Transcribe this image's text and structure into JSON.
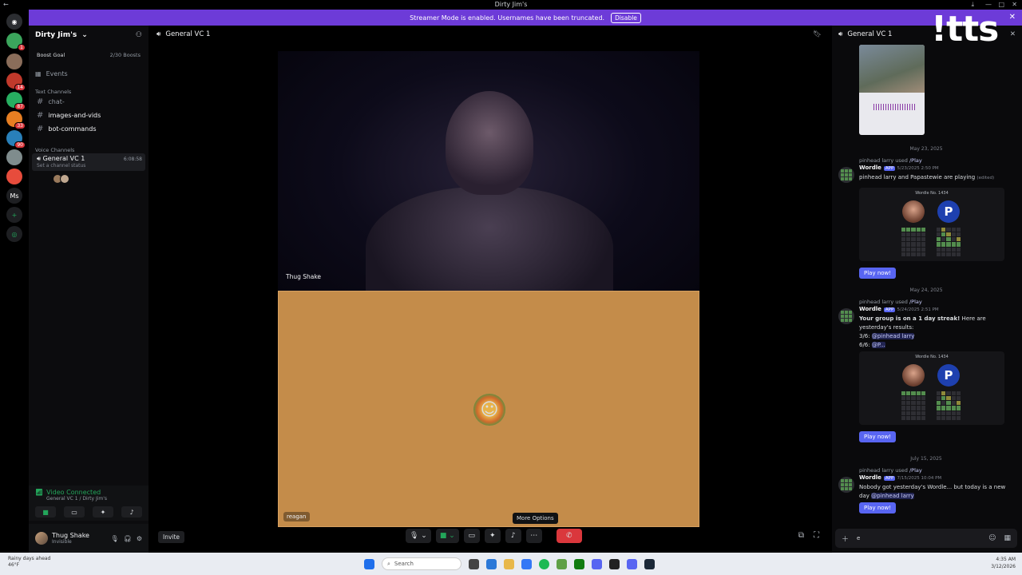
{
  "window": {
    "title": "Dirty Jim's"
  },
  "banner": {
    "text": "Streamer Mode is enabled. Usernames have been truncated.",
    "button": "Disable"
  },
  "guilds": [
    {
      "label": "",
      "color": "#2b2d31",
      "badge": ""
    },
    {
      "label": "",
      "color": "#3ba55c",
      "badge": "1"
    },
    {
      "label": "",
      "color": "#8a6d5a",
      "badge": ""
    },
    {
      "label": "",
      "color": "#c0392b",
      "badge": "14"
    },
    {
      "label": "",
      "color": "#27ae60",
      "badge": "87"
    },
    {
      "label": "",
      "color": "#e67e22",
      "badge": "33"
    },
    {
      "label": "",
      "color": "#2980b9",
      "badge": "90"
    },
    {
      "label": "",
      "color": "#7f8c8d",
      "badge": ""
    },
    {
      "label": "",
      "color": "#e74c3c",
      "badge": ""
    },
    {
      "label": "Ms",
      "color": "#1e1f22",
      "badge": ""
    }
  ],
  "server": {
    "name": "Dirty Jim's",
    "boost_label": "Boost Goal",
    "boost_count": "2/30 Boosts",
    "events": "Events",
    "text_category": "Text Channels",
    "text_channels": [
      "chat-",
      "images-and-vids",
      "bot-commands"
    ],
    "voice_category": "Voice Channels",
    "voice_channel": {
      "name": "General VC 1",
      "status": "Set a channel status",
      "time": "6:08:58"
    }
  },
  "connection": {
    "title": "Video Connected",
    "sub": "General VC 1 / Dirty Jim's"
  },
  "user": {
    "name": "Thug Shake",
    "status": "Invisible"
  },
  "stage": {
    "header": "General VC 1",
    "cam_name": "Thug Shake",
    "tile2_name": "reagan",
    "tooltip": "More Options",
    "invite": "Invite"
  },
  "chat": {
    "header": "General VC 1",
    "overlay": "!tts",
    "messages": [
      {
        "date": "May 23, 2025",
        "used_user": "pinhead larry",
        "used_cmd": "/Play",
        "bot": "Wordle",
        "app": "APP",
        "time": "5/23/2025 2:50 PM",
        "body": "pinhead larry and Papastewie are playing",
        "edited": "(edited)",
        "card_title": "Wordle No. 1434",
        "play": "Play now!"
      },
      {
        "date": "May 24, 2025",
        "used_user": "pinhead larry",
        "used_cmd": "/Play",
        "bot": "Wordle",
        "app": "APP",
        "time": "5/24/2025 2:51 PM",
        "streak": "Your group is on a 1 day streak!",
        "streak_tail": " Here are yesterday's results:",
        "r1": "3/6:",
        "r1_ment": "@pinhead larry",
        "r2": "6/6:",
        "r2_ment": "@P...",
        "card_title": "Wordle No. 1434",
        "play": "Play now!"
      },
      {
        "date": "July 15, 2025",
        "used_user": "pinhead larry",
        "used_cmd": "/Play",
        "bot": "Wordle",
        "app": "APP",
        "time": "7/15/2025 10:04 PM",
        "body": "Nobody got yesterday's Wordle... but today is a new day",
        "ment": "@pinhead larry",
        "play": "Play now!"
      }
    ],
    "input_value": "e"
  },
  "taskbar": {
    "weather": "Rainy days ahead",
    "temp": "46°F",
    "search": "Search",
    "time": "4:35 AM",
    "date": "3/12/2026"
  }
}
